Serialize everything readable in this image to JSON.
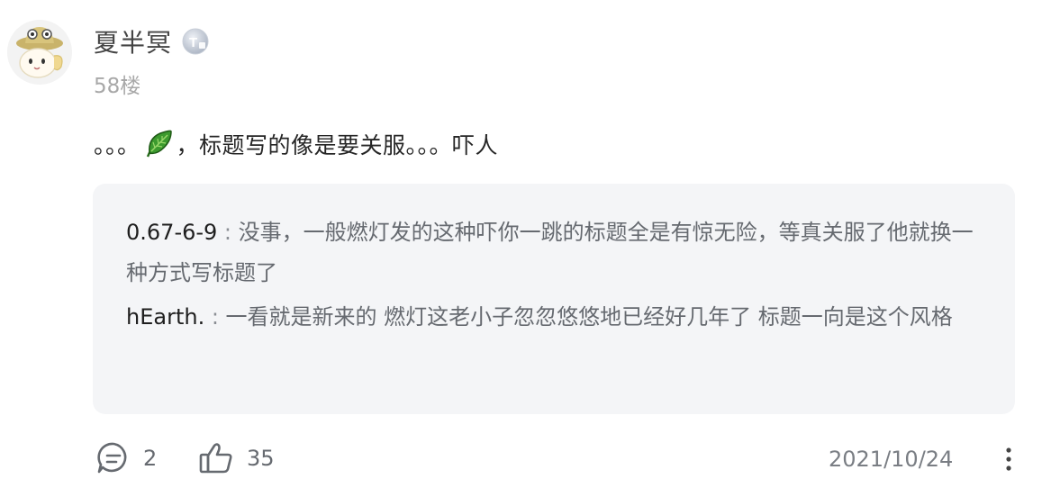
{
  "author": {
    "name": "夏半冥",
    "level_badge": "T"
  },
  "post": {
    "floor": "58楼",
    "text_before": "。。。",
    "emoji": "leaf-icon",
    "text_after": "，标题写的像是要关服。。。吓人"
  },
  "replies": [
    {
      "user": "0.67-6-9",
      "sep": " : ",
      "text": "没事，一般燃灯发的这种吓你一跳的标题全是有惊无险，等真关服了他就换一种方式写标题了"
    },
    {
      "user": "hEarth.",
      "sep": " : ",
      "text": "一看就是新来的 燃灯这老小子忽忽悠悠地已经好几年了 标题一向是这个风格"
    }
  ],
  "footer": {
    "comment_count": "2",
    "like_count": "35",
    "date": "2021/10/24"
  },
  "colors": {
    "reply_bg": "#f4f5f7",
    "muted": "#a8a8a8",
    "text": "#262626",
    "leaf_green": "#3c9a2e"
  }
}
